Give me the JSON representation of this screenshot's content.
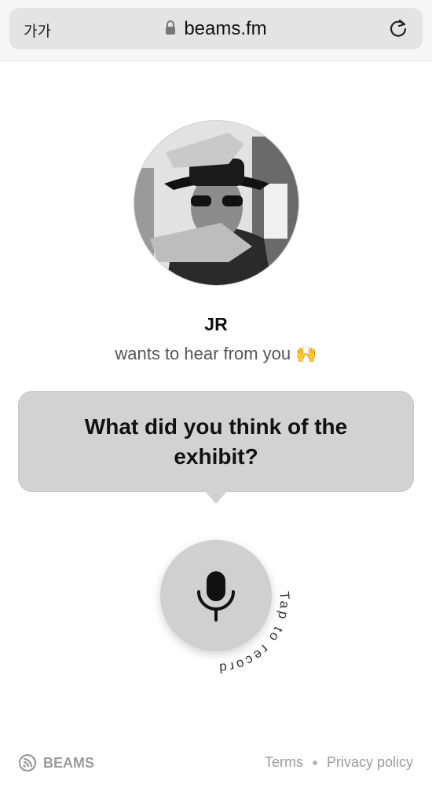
{
  "browser": {
    "text_size_label": "가가",
    "url": "beams.fm"
  },
  "profile": {
    "name": "JR",
    "subtitle": "wants to hear from you 🙌"
  },
  "prompt": {
    "question": "What did you think of the exhibit?"
  },
  "record": {
    "label": "Tap to record"
  },
  "footer": {
    "brand": "BEAMS",
    "terms": "Terms",
    "privacy": "Privacy policy"
  },
  "colors": {
    "bubble": "#d2d2d2",
    "button": "#d0d0d0",
    "footer_text": "#9b9b9b"
  }
}
